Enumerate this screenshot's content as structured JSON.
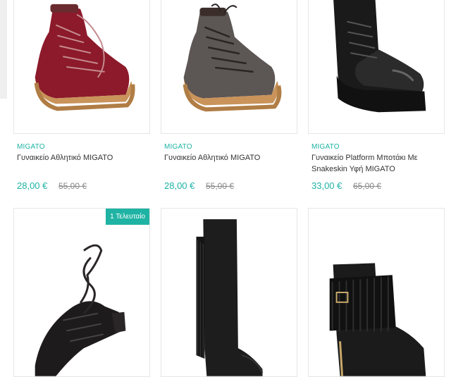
{
  "products_top": [
    {
      "brand": "MIGATO",
      "name": "Γυναικείο Αθλητικό MIGATO",
      "price": "28,00 €",
      "old_price": "55,00 €",
      "image_icon": "red-hiker-boot-image"
    },
    {
      "brand": "MIGATO",
      "name": "Γυναικείο Αθλητικό MIGATO",
      "price": "28,00 €",
      "old_price": "55,00 €",
      "image_icon": "grey-hiker-boot-image"
    },
    {
      "brand": "MIGATO",
      "name": "Γυναικείο Platform Μποτάκι Με Snakeskin Υφή MIGATO",
      "price": "33,00 €",
      "old_price": "65,00 €",
      "image_icon": "black-platform-boot-image"
    }
  ],
  "products_bottom": [
    {
      "badge": "1 Τελευταίο",
      "image_icon": "black-laceup-heel-image"
    },
    {
      "image_icon": "black-fringe-tall-boot-image"
    },
    {
      "image_icon": "black-fringe-ankle-boot-image"
    }
  ],
  "colors": {
    "accent": "#1fb3a4",
    "border": "#e6e6e6"
  }
}
